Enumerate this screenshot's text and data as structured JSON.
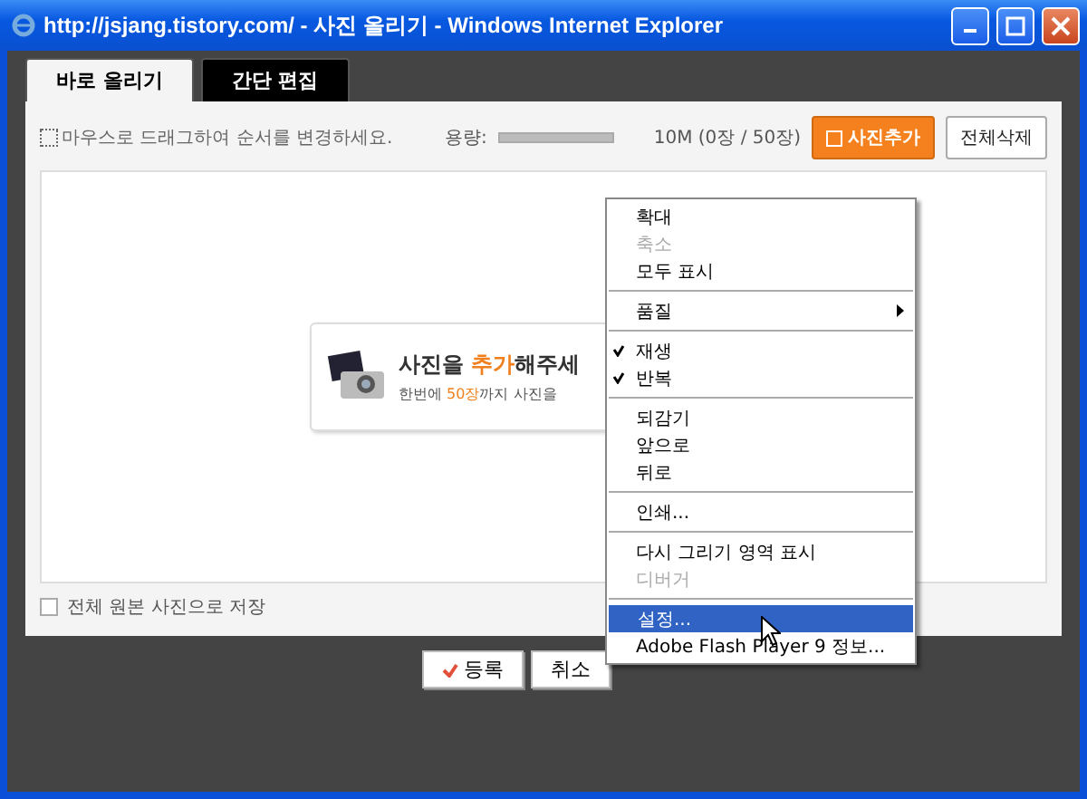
{
  "window": {
    "title": "http://jsjang.tistory.com/ - 사진 올리기 - Windows Internet Explorer"
  },
  "tabs": [
    {
      "label": "바로 올리기",
      "selected": true
    },
    {
      "label": "간단 편집",
      "selected": false
    }
  ],
  "toolbar": {
    "hint": "마우스로 드래그하여 순서를 변경하세요.",
    "capacity_label": "용량:",
    "capacity": {
      "level": 0
    },
    "capacity_text": "10M (0장 / 50장)",
    "buttons": [
      {
        "label": "사진추가",
        "kind": "primary"
      },
      {
        "label": "전체삭제",
        "kind": "plain"
      }
    ]
  },
  "drop_area": {
    "headline": "사진을 **추가**해주세",
    "subline": "한번에 **50장**까지 사진을"
  },
  "original_checkbox": {
    "label": "전체 원본 사진으로 저장",
    "checked": false
  },
  "buttons": [
    {
      "label": "등록",
      "kind": "confirm"
    },
    {
      "label": "취소",
      "kind": "plain"
    }
  ],
  "context_menu": {
    "items": [
      {
        "kind": "item",
        "label": "확대",
        "disabled": false,
        "checked": false,
        "submenu": false,
        "selected": false
      },
      {
        "kind": "item",
        "label": "축소",
        "disabled": true,
        "checked": false,
        "submenu": false,
        "selected": false
      },
      {
        "kind": "item",
        "label": "모두 표시",
        "disabled": false,
        "checked": false,
        "submenu": false,
        "selected": false
      },
      {
        "kind": "separator"
      },
      {
        "kind": "item",
        "label": "품질",
        "disabled": false,
        "checked": false,
        "submenu": true,
        "selected": false
      },
      {
        "kind": "separator"
      },
      {
        "kind": "item",
        "label": "재생",
        "disabled": false,
        "checked": true,
        "submenu": false,
        "selected": false
      },
      {
        "kind": "item",
        "label": "반복",
        "disabled": false,
        "checked": true,
        "submenu": false,
        "selected": false
      },
      {
        "kind": "separator"
      },
      {
        "kind": "item",
        "label": "되감기",
        "disabled": false,
        "checked": false,
        "submenu": false,
        "selected": false
      },
      {
        "kind": "item",
        "label": "앞으로",
        "disabled": false,
        "checked": false,
        "submenu": false,
        "selected": false
      },
      {
        "kind": "item",
        "label": "뒤로",
        "disabled": false,
        "checked": false,
        "submenu": false,
        "selected": false
      },
      {
        "kind": "separator"
      },
      {
        "kind": "item",
        "label": "인쇄...",
        "disabled": false,
        "checked": false,
        "submenu": false,
        "selected": false
      },
      {
        "kind": "separator"
      },
      {
        "kind": "item",
        "label": "다시 그리기 영역 표시",
        "disabled": false,
        "checked": false,
        "submenu": false,
        "selected": false
      },
      {
        "kind": "item",
        "label": "디버거",
        "disabled": true,
        "checked": false,
        "submenu": false,
        "selected": false
      },
      {
        "kind": "separator"
      },
      {
        "kind": "item",
        "label": "설정...",
        "disabled": false,
        "checked": false,
        "submenu": false,
        "selected": true
      },
      {
        "kind": "item",
        "label": "Adobe Flash Player 9 정보...",
        "disabled": false,
        "checked": false,
        "submenu": false,
        "selected": false
      }
    ]
  }
}
